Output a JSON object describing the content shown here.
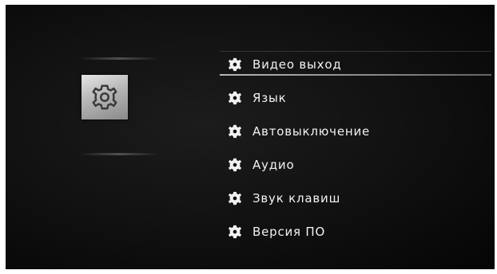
{
  "screen": {
    "panel_icon": "settings-gear-icon"
  },
  "menu": {
    "selected_index": 0,
    "items": [
      {
        "label": "Видео выход",
        "icon": "gear-icon"
      },
      {
        "label": "Язык",
        "icon": "gear-icon"
      },
      {
        "label": "Автовыключение",
        "icon": "gear-icon"
      },
      {
        "label": "Аудио",
        "icon": "gear-icon"
      },
      {
        "label": "Звук клавиш",
        "icon": "gear-icon"
      },
      {
        "label": "Версия ПО",
        "icon": "gear-icon"
      }
    ]
  }
}
